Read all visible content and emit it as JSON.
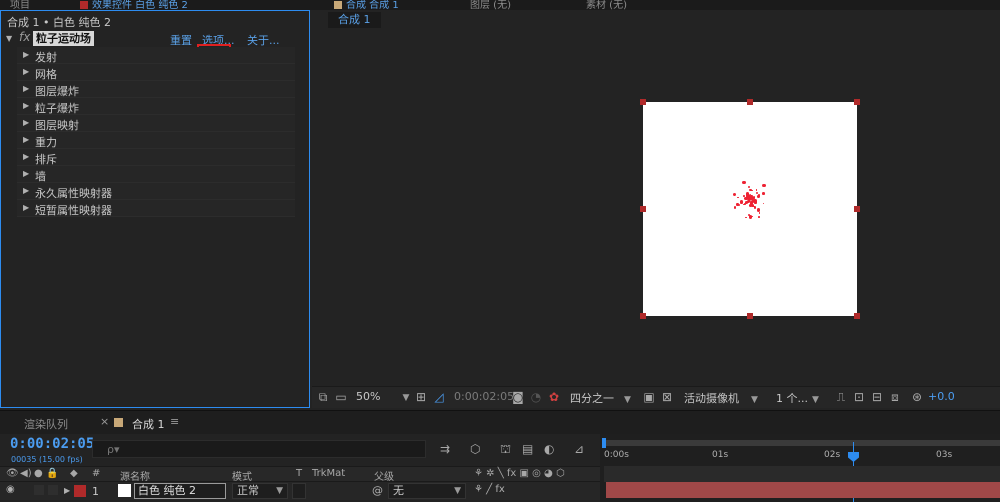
{
  "top_tabs": [
    "项目",
    "效果控件 白色 纯色 2",
    "合成 合成 1",
    "图层 (无)",
    "素材 (无)"
  ],
  "effects_panel": {
    "breadcrumb": "合成 1 • 白色 纯色 2",
    "fx": "fx",
    "effect_name": "粒子运动场",
    "reset": "重置",
    "options": "选项...",
    "about": "关于...",
    "properties": [
      "发射",
      "网格",
      "图层爆炸",
      "粒子爆炸",
      "图层映射",
      "重力",
      "排斥",
      "墙",
      "永久属性映射器",
      "短暂属性映射器"
    ]
  },
  "viewer": {
    "tab": "合成 1",
    "toolbar": {
      "zoom": "50%",
      "timecode": "0:00:02:05",
      "resolution": "四分之一",
      "camera": "活动摄像机",
      "views": "1 个...",
      "exposure": "+0.0"
    }
  },
  "timeline": {
    "tabs": [
      "渲染队列",
      "合成 1"
    ],
    "timecode": "0:00:02:05",
    "fps": "00035 (15.00 fps)",
    "search_placeholder": "ρ▾",
    "columns": {
      "number": "#",
      "source_name": "源名称",
      "mode": "模式",
      "t": "T",
      "trkmat": "TrkMat",
      "parent": "父级"
    },
    "layer": {
      "number": "1",
      "name": "白色 纯色 2",
      "mode": "正常",
      "parent": "无"
    },
    "ruler": [
      "0:00s",
      "01s",
      "02s",
      "03s"
    ]
  },
  "colors": {
    "accent": "#2d8cf0",
    "timecode": "#4b9cf0",
    "highlight": "#e02020",
    "layer_bar": "#a04848",
    "particles": "#ee2233"
  }
}
